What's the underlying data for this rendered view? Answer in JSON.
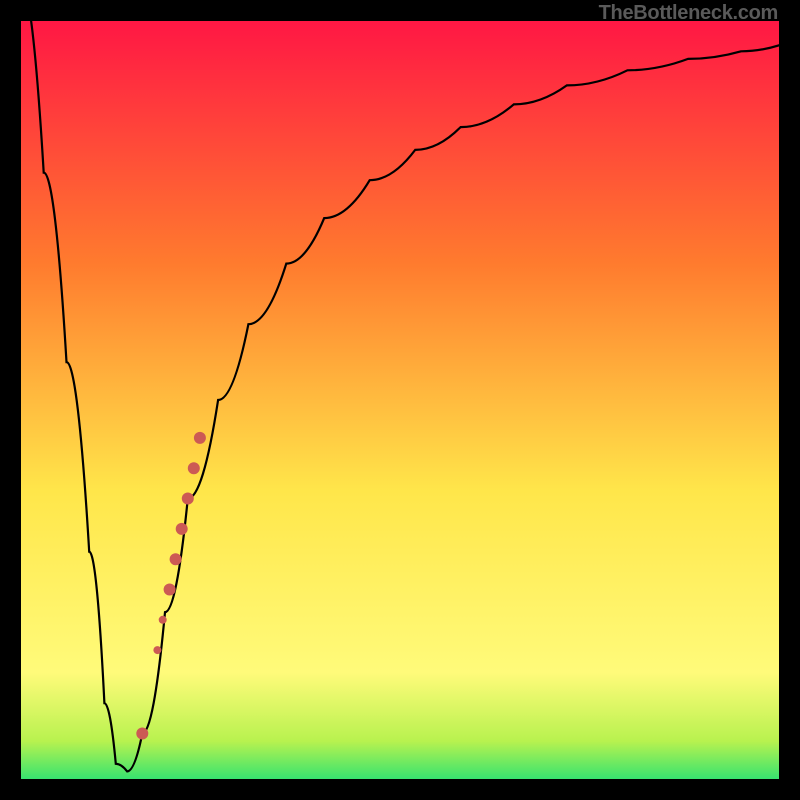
{
  "watermark": "TheBottleneck.com",
  "colors": {
    "frame": "#000000",
    "gradient_top": "#ff1744",
    "gradient_mid1": "#ff7b2e",
    "gradient_mid2": "#ffe64a",
    "gradient_low": "#fffb7a",
    "gradient_green": "#37e36f",
    "curve": "#000000",
    "dot": "#cc5a54"
  },
  "chart_data": {
    "type": "line",
    "title": "",
    "xlabel": "",
    "ylabel": "",
    "xlim": [
      0,
      100
    ],
    "ylim": [
      0,
      100
    ],
    "series": [
      {
        "name": "bottleneck-curve",
        "x": [
          0,
          3,
          6,
          9,
          11,
          12.5,
          14,
          16,
          19,
          22,
          26,
          30,
          35,
          40,
          46,
          52,
          58,
          65,
          72,
          80,
          88,
          95,
          100
        ],
        "values": [
          105,
          80,
          55,
          30,
          10,
          2,
          1,
          6,
          22,
          37,
          50,
          60,
          68,
          74,
          79,
          83,
          86,
          89,
          91.5,
          93.5,
          95,
          96,
          96.8
        ]
      }
    ],
    "markers": [
      {
        "x": 16.0,
        "y": 6.0,
        "r": 6
      },
      {
        "x": 18.0,
        "y": 17.0,
        "r": 4
      },
      {
        "x": 18.7,
        "y": 21.0,
        "r": 4
      },
      {
        "x": 19.6,
        "y": 25.0,
        "r": 6
      },
      {
        "x": 20.4,
        "y": 29.0,
        "r": 6
      },
      {
        "x": 21.2,
        "y": 33.0,
        "r": 6
      },
      {
        "x": 22.0,
        "y": 37.0,
        "r": 6
      },
      {
        "x": 22.8,
        "y": 41.0,
        "r": 6
      },
      {
        "x": 23.6,
        "y": 45.0,
        "r": 6
      }
    ]
  }
}
